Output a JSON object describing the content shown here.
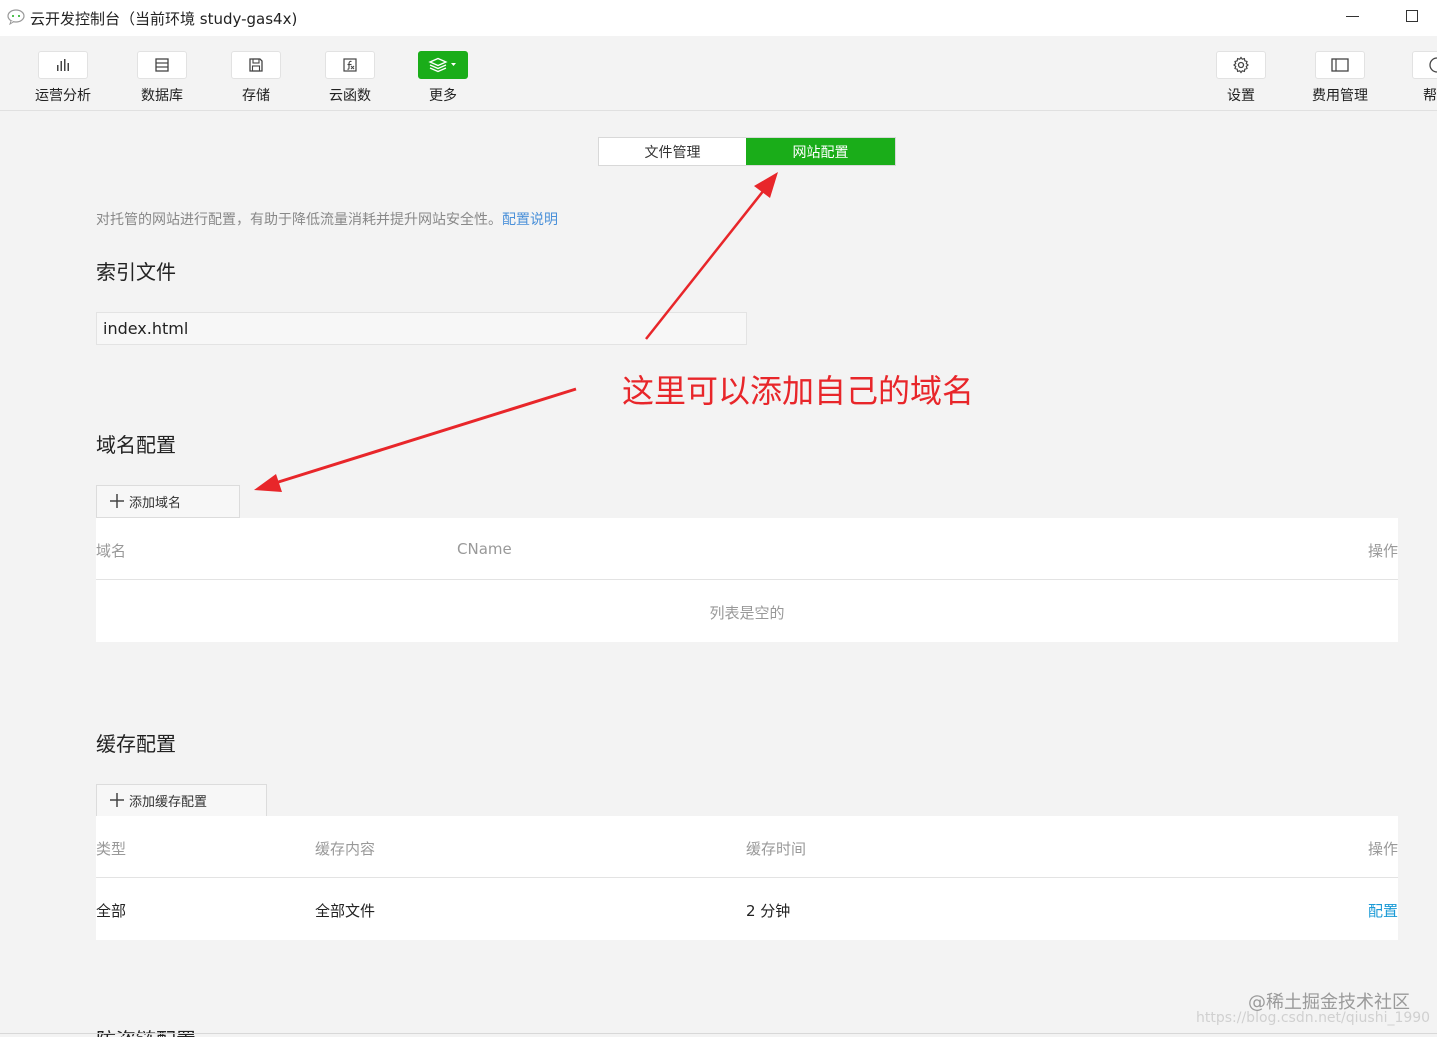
{
  "window": {
    "title": "云开发控制台（当前环境 study-gas4x)"
  },
  "toolbar": {
    "left": [
      {
        "label": "运营分析",
        "icon": "bar-chart-icon"
      },
      {
        "label": "数据库",
        "icon": "database-icon"
      },
      {
        "label": "存储",
        "icon": "storage-icon"
      },
      {
        "label": "云函数",
        "icon": "function-icon"
      },
      {
        "label": "更多",
        "icon": "layers-icon"
      }
    ],
    "right": [
      {
        "label": "设置",
        "icon": "gear-icon"
      },
      {
        "label": "费用管理",
        "icon": "billing-icon"
      },
      {
        "label": "帮",
        "icon": "help-icon"
      }
    ]
  },
  "tabs": {
    "file_management": "文件管理",
    "site_config": "网站配置",
    "active": "网站配置"
  },
  "description": {
    "text": "对托管的网站进行配置，有助于降低流量消耗并提升网站安全性。",
    "link": "配置说明"
  },
  "index_section": {
    "title": "索引文件",
    "value": "index.html"
  },
  "annotation": {
    "text": "这里可以添加自己的域名",
    "color": "#e8262a"
  },
  "domain_section": {
    "title": "域名配置",
    "add_button": "添加域名",
    "columns": [
      "域名",
      "CName",
      "操作"
    ],
    "empty_text": "列表是空的"
  },
  "cache_section": {
    "title": "缓存配置",
    "add_button": "添加缓存配置",
    "columns": [
      "类型",
      "缓存内容",
      "缓存时间",
      "操作"
    ],
    "rows": [
      {
        "type": "全部",
        "content": "全部文件",
        "time": "2 分钟",
        "action": "配置"
      }
    ]
  },
  "next_section_title": "防盗链配置",
  "watermark": {
    "line1": "@稀土掘金技术社区",
    "line2": "https://blog.csdn.net/qiushi_1990"
  },
  "colors": {
    "accent": "#1aad19",
    "link": "#1a9ad6",
    "background": "#f3f3f3"
  }
}
